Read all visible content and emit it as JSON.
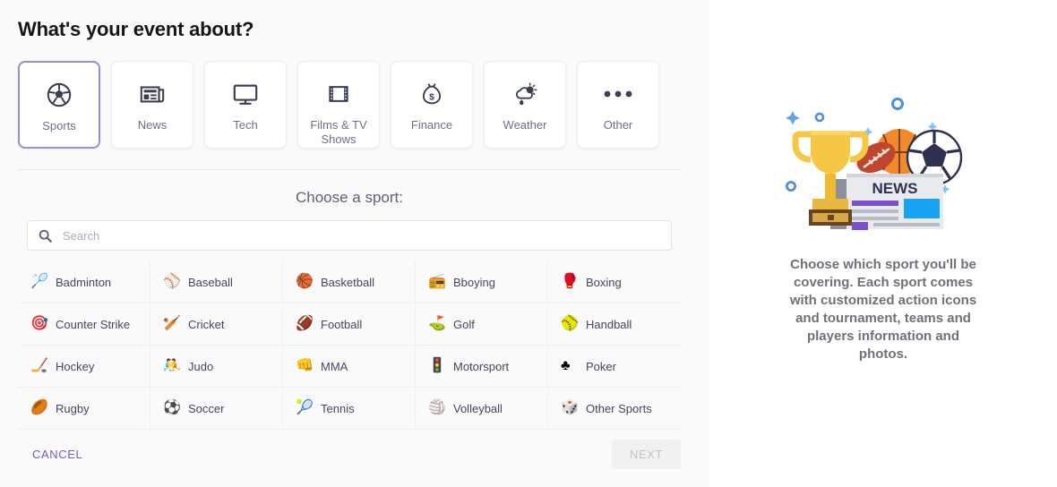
{
  "page": {
    "title": "What's your event about?"
  },
  "categories": [
    {
      "label": "Sports",
      "icon": "soccer-ball-icon",
      "selected": true
    },
    {
      "label": "News",
      "icon": "newspaper-icon",
      "selected": false
    },
    {
      "label": "Tech",
      "icon": "monitor-icon",
      "selected": false
    },
    {
      "label": "Films & TV Shows",
      "icon": "film-strip-icon",
      "selected": false
    },
    {
      "label": "Finance",
      "icon": "money-bag-icon",
      "selected": false
    },
    {
      "label": "Weather",
      "icon": "cloud-sun-rain-icon",
      "selected": false
    },
    {
      "label": "Other",
      "icon": "ellipsis-icon",
      "selected": false
    }
  ],
  "chooser": {
    "heading": "Choose a sport:",
    "search": {
      "placeholder": "Search",
      "value": "",
      "icon": "search-icon"
    }
  },
  "sports": [
    {
      "label": "Badminton",
      "emoji": "🏸"
    },
    {
      "label": "Baseball",
      "emoji": "⚾"
    },
    {
      "label": "Basketball",
      "emoji": "🏀"
    },
    {
      "label": "Bboying",
      "emoji": "📻"
    },
    {
      "label": "Boxing",
      "emoji": "🥊"
    },
    {
      "label": "Counter Strike",
      "emoji": "🎯"
    },
    {
      "label": "Cricket",
      "emoji": "🏏"
    },
    {
      "label": "Football",
      "emoji": "🏈"
    },
    {
      "label": "Golf",
      "emoji": "⛳"
    },
    {
      "label": "Handball",
      "emoji": "🥎"
    },
    {
      "label": "Hockey",
      "emoji": "🏒"
    },
    {
      "label": "Judo",
      "emoji": "🤼"
    },
    {
      "label": "MMA",
      "emoji": "👊"
    },
    {
      "label": "Motorsport",
      "emoji": "🚦"
    },
    {
      "label": "Poker",
      "emoji": "♣"
    },
    {
      "label": "Rugby",
      "emoji": "🏉"
    },
    {
      "label": "Soccer",
      "emoji": "⚽"
    },
    {
      "label": "Tennis",
      "emoji": "🎾"
    },
    {
      "label": "Volleyball",
      "emoji": "🏐"
    },
    {
      "label": "Other Sports",
      "emoji": "🎲"
    }
  ],
  "footer": {
    "cancel_label": "CANCEL",
    "next_label": "NEXT"
  },
  "side": {
    "description": "Choose which sport you'll be covering. Each sport comes with customized action icons and tournament, teams and players information and photos.",
    "illustration": "sports-news-trophy-illustration"
  },
  "colors": {
    "accent": "#6b5fbf",
    "selected_border": "#9b8fd4",
    "icon_dark": "#3b3f54",
    "panel_bg": "#fafafa"
  }
}
